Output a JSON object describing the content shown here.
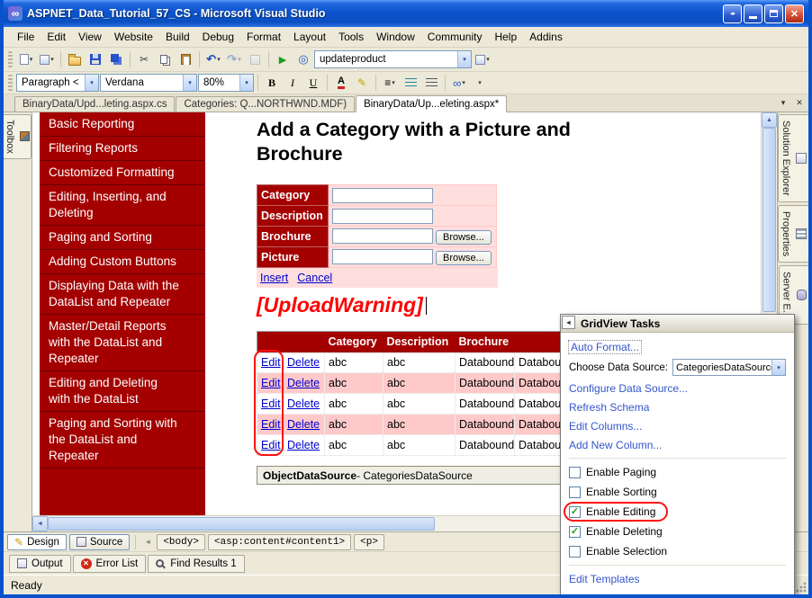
{
  "window": {
    "title": "ASPNET_Data_Tutorial_57_CS - Microsoft Visual Studio",
    "status": "Ready"
  },
  "menu": {
    "items": [
      "File",
      "Edit",
      "View",
      "Website",
      "Build",
      "Debug",
      "Format",
      "Layout",
      "Tools",
      "Window",
      "Community",
      "Help",
      "Addins"
    ]
  },
  "toolbars": {
    "search_combo": "updateproduct",
    "block_format": "Paragraph <",
    "font_name": "Verdana",
    "zoom": "80%"
  },
  "icons": {
    "logo": "∞",
    "float": "◂▸",
    "close": "✕",
    "dropdown": "▾",
    "cut": "✂",
    "undo": "↶",
    "redo": "↷",
    "play": "▶",
    "preview": "◎",
    "bold": "B",
    "italic": "I",
    "underline": "U",
    "fontcolor": "A",
    "align": "≡",
    "link": "∞",
    "up": "▲",
    "down": "▼",
    "left": "◄",
    "right": "►",
    "collapse": "◂",
    "check": "✓",
    "pencil": "✎",
    "chev": "◄"
  },
  "doc_tabs": {
    "tab1": "BinaryData/Upd...leting.aspx.cs",
    "tab2": "Categories: Q...NORTHWND.MDF)",
    "tab3": "BinaryData/Up...eleting.aspx*"
  },
  "panels": {
    "toolbox": "Toolbox",
    "solution_explorer": "Solution Explorer",
    "properties": "Properties",
    "server_explorer": "Server E..."
  },
  "design": {
    "nav": [
      "Basic Reporting",
      "Filtering Reports",
      "Customized Formatting",
      "Editing, Inserting, and Deleting",
      "Paging and Sorting",
      "Adding Custom Buttons",
      "Displaying Data with the DataList and Repeater",
      "Master/Detail Reports with the DataList and Repeater",
      "Editing and Deleting with the DataList",
      "Paging and Sorting with the DataList and Repeater"
    ],
    "heading": "Add a Category with a Picture and Brochure",
    "form": {
      "labels": [
        "Category",
        "Description",
        "Brochure",
        "Picture"
      ],
      "browse": "Browse...",
      "insert": "Insert",
      "cancel": "Cancel"
    },
    "warning": "[UploadWarning]",
    "grid": {
      "headers": [
        "",
        "",
        "Category",
        "Description",
        "Brochure",
        ""
      ],
      "row": [
        "Edit",
        "Delete",
        "abc",
        "abc",
        "Databound",
        "Databound"
      ]
    },
    "datasource": {
      "bold": "ObjectDataSource",
      "rest": " - CategoriesDataSource"
    }
  },
  "tasks": {
    "title": "GridView Tasks",
    "auto_format": "Auto Format...",
    "choose_label": "Choose Data Source:",
    "choose_value": "CategoriesDataSource",
    "configure": "Configure Data Source...",
    "refresh": "Refresh Schema",
    "edit_columns": "Edit Columns...",
    "add_column": "Add New Column...",
    "enable_paging": "Enable Paging",
    "enable_sorting": "Enable Sorting",
    "enable_editing": "Enable Editing",
    "enable_deleting": "Enable Deleting",
    "enable_selection": "Enable Selection",
    "edit_templates": "Edit Templates"
  },
  "viewbar": {
    "design": "Design",
    "source": "Source",
    "tag_body": "<body>",
    "tag_content": "<asp:content#content1>",
    "tag_p": "<p>"
  },
  "bottom_tabs": {
    "output": "Output",
    "error_list": "Error List",
    "find_results": "Find Results 1"
  }
}
